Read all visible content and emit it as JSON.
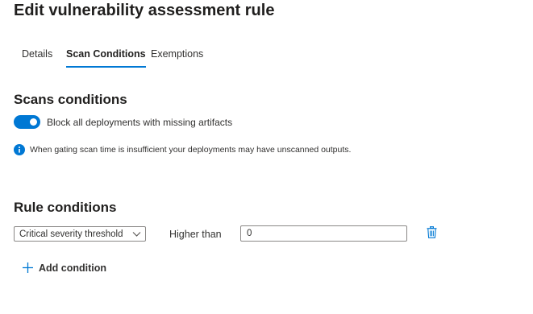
{
  "page": {
    "title": "Edit vulnerability assessment rule"
  },
  "tabs": [
    {
      "label": "Details",
      "active": false
    },
    {
      "label": "Scan Conditions",
      "active": true
    },
    {
      "label": "Exemptions",
      "active": false
    }
  ],
  "scan_conditions": {
    "title": "Scans conditions",
    "toggle": {
      "label": "Block all deployments with missing artifacts",
      "checked": true
    },
    "info": {
      "icon": "info-icon",
      "text": "When gating scan time is insufficient your deployments may have unscanned outputs."
    }
  },
  "rule_conditions": {
    "title": "Rule conditions",
    "rows": [
      {
        "severity": "Critical severity threshold",
        "operator": "Higher than",
        "value": "0",
        "delete_icon": "trash-icon"
      }
    ],
    "add_label": "Add condition"
  },
  "colors": {
    "accent": "#0078d4",
    "text": "#323130",
    "border": "#8a8886"
  }
}
